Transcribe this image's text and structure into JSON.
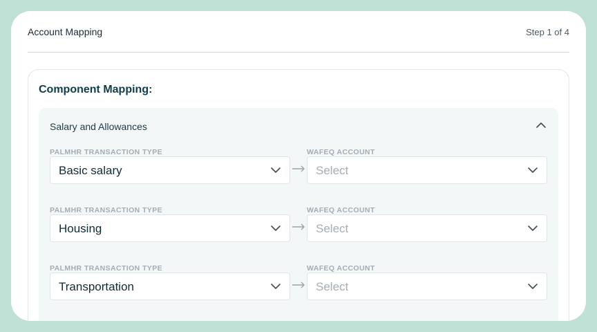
{
  "header": {
    "title": "Account Mapping",
    "step": "Step 1 of 4"
  },
  "panel": {
    "title": "Component Mapping:"
  },
  "group": {
    "title": "Salary and Allowances",
    "rows": [
      {
        "left_label": "PALMHR TRANSACTION TYPE",
        "left_value": "Basic salary",
        "right_label": "WAFEQ ACCOUNT",
        "right_value": "Select"
      },
      {
        "left_label": "PALMHR TRANSACTION TYPE",
        "left_value": "Housing",
        "right_label": "WAFEQ ACCOUNT",
        "right_value": "Select"
      },
      {
        "left_label": "PALMHR TRANSACTION TYPE",
        "left_value": "Transportation",
        "right_label": "WAFEQ ACCOUNT",
        "right_value": "Select"
      }
    ]
  },
  "icons": {
    "collapse": "chevron-up-icon",
    "dropdown": "chevron-down-icon",
    "mapping": "arrow-right-icon"
  },
  "colors": {
    "background": "#bfe0d4",
    "card": "#ffffff",
    "group": "#f3f7f7",
    "title": "#0e3d4a",
    "placeholder": "#a4aeb4",
    "label": "#a3adb3"
  }
}
